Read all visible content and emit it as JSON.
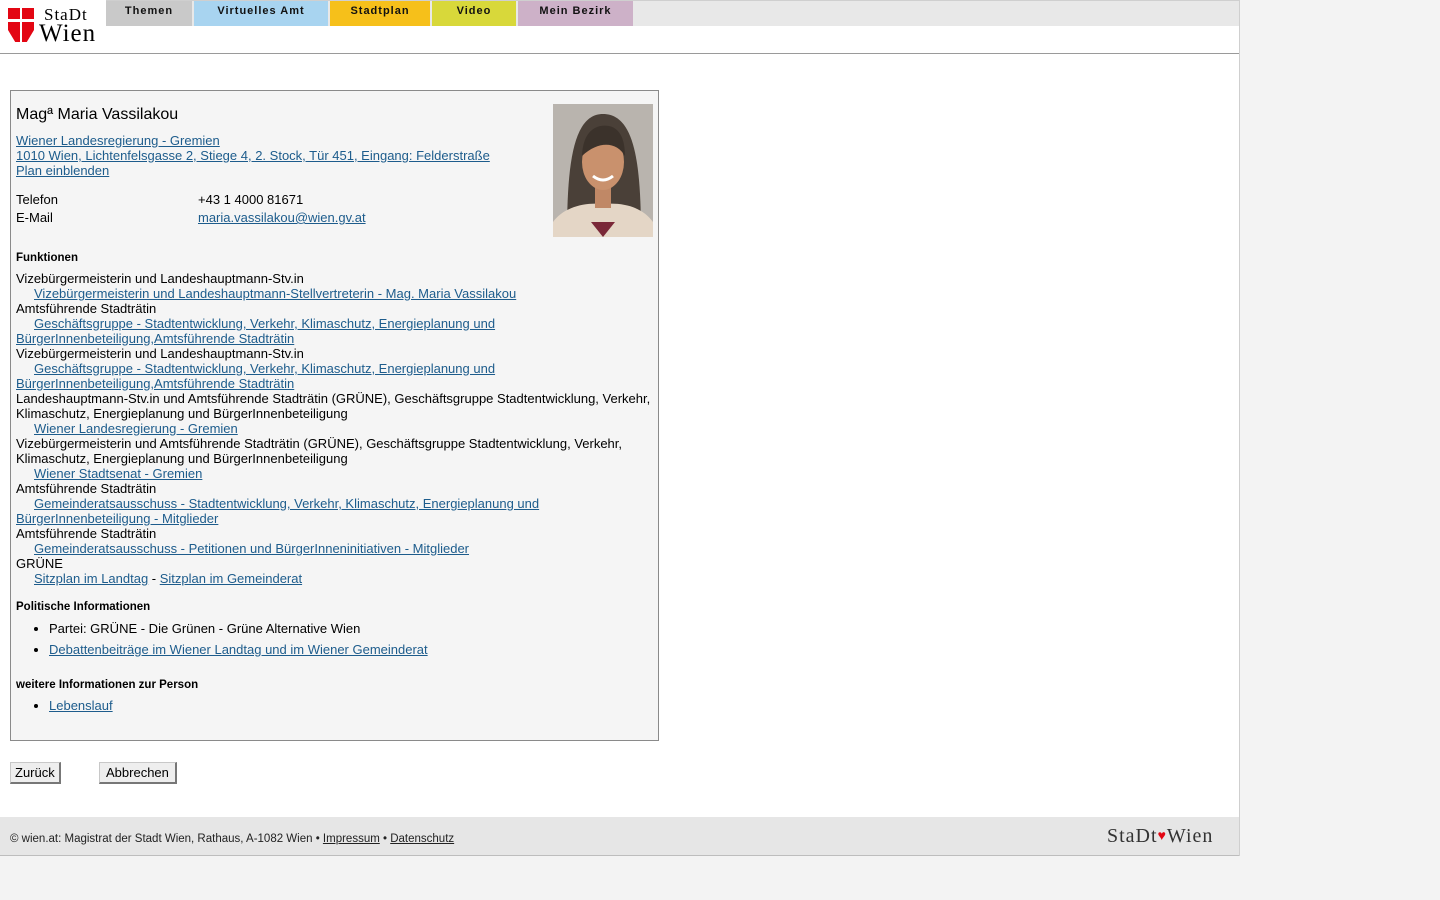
{
  "header": {
    "logo_top": "StaDt",
    "logo_bottom": "Wien",
    "nav": [
      {
        "label": "Themen",
        "color": "#c9c9c9"
      },
      {
        "label": "Virtuelles Amt",
        "color": "#a8d4f0"
      },
      {
        "label": "Stadtplan",
        "color": "#f6c01a"
      },
      {
        "label": "Video",
        "color": "#d8d83a"
      },
      {
        "label": "Mein Bezirk",
        "color": "#cdb1c8"
      }
    ]
  },
  "person": {
    "name": "Magª Maria Vassilakou",
    "org_link": "Wiener Landesregierung - Gremien ",
    "address_link": "1010 Wien, Lichtenfelsgasse 2, Stiege 4, 2. Stock, Tür 451, Eingang: Felderstraße",
    "map_link": "Plan einblenden",
    "phone_label": "Telefon",
    "phone": "+43 1 4000 81671",
    "email_label": "E-Mail",
    "email": "maria.vassilakou@wien.gv.at"
  },
  "functions": {
    "title": "Funktionen",
    "items": [
      {
        "role": "Vizebürgermeisterin und Landeshauptmann-Stv.in",
        "link": "Vizebürgermeisterin und Landeshauptmann-Stellvertreterin - Mag. Maria Vassilakou"
      },
      {
        "role": "Amtsführende Stadträtin",
        "link": "Geschäftsgruppe - Stadtentwicklung, Verkehr, Klimaschutz, Energieplanung und BürgerInnenbeteiligung,Amtsführende Stadträtin"
      },
      {
        "role": "Vizebürgermeisterin und Landeshauptmann-Stv.in",
        "link": "Geschäftsgruppe - Stadtentwicklung, Verkehr, Klimaschutz, Energieplanung und BürgerInnenbeteiligung,Amtsführende Stadträtin"
      },
      {
        "role": "Landeshauptmann-Stv.in und Amtsführende Stadträtin (GRÜNE), Geschäftsgruppe Stadtentwicklung, Verkehr, Klimaschutz, Energieplanung und BürgerInnenbeteiligung",
        "link": "Wiener Landesregierung - Gremien"
      },
      {
        "role": "Vizebürgermeisterin und Amtsführende Stadträtin (GRÜNE), Geschäftsgruppe Stadtentwicklung, Verkehr, Klimaschutz, Energieplanung und BürgerInnenbeteiligung",
        "link": "Wiener Stadtsenat - Gremien"
      },
      {
        "role": "Amtsführende Stadträtin",
        "link": "Gemeinderatsausschuss - Stadtentwicklung, Verkehr, Klimaschutz, Energieplanung und BürgerInnenbeteiligung - Mitglieder"
      },
      {
        "role": "Amtsführende Stadträtin",
        "link": "Gemeinderatsausschuss - Petitionen und BürgerInneninitiativen - Mitglieder"
      }
    ],
    "party_role": "GRÜNE",
    "seat_link_1": "Sitzplan im Landtag",
    "seat_sep": " - ",
    "seat_link_2": "Sitzplan im Gemeinderat"
  },
  "political": {
    "title": "Politische Informationen",
    "party": "Partei: GRÜNE - Die Grünen - Grüne Alternative Wien",
    "debates_link": "Debattenbeiträge im Wiener Landtag und im Wiener Gemeinderat"
  },
  "more": {
    "title": "weitere Informationen zur Person",
    "cv_link": "Lebenslauf"
  },
  "buttons": {
    "back": "Zurück",
    "cancel": "Abbrechen"
  },
  "footer": {
    "text": "© wien.at: Magistrat der Stadt Wien, Rathaus, A-1082 Wien • ",
    "impressum": "Impressum",
    "sep": " • ",
    "datenschutz": "Datenschutz",
    "logo_left": "StaDt",
    "logo_right": "Wien"
  }
}
